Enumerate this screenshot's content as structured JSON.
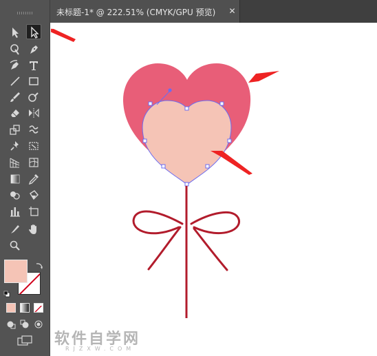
{
  "document": {
    "tab_title": "未标题-1* @ 222.51% (CMYK/GPU 预览)",
    "close_glyph": "✕"
  },
  "toolbar": {
    "tools": [
      {
        "name": "selection-tool",
        "icon": "arrow-black-icon"
      },
      {
        "name": "direct-selection-tool",
        "icon": "arrow-white-icon",
        "active": true
      },
      {
        "name": "magic-wand-tool",
        "icon": "magic-wand-icon"
      },
      {
        "name": "pen-tool",
        "icon": "pen-icon"
      },
      {
        "name": "curvature-tool",
        "icon": "curvature-icon"
      },
      {
        "name": "type-tool",
        "icon": "type-icon"
      },
      {
        "name": "line-tool",
        "icon": "line-segment-icon"
      },
      {
        "name": "rectangle-tool",
        "icon": "rectangle-icon"
      },
      {
        "name": "paintbrush-tool",
        "icon": "paintbrush-icon"
      },
      {
        "name": "shaper-tool",
        "icon": "shaper-icon"
      },
      {
        "name": "eraser-tool",
        "icon": "eraser-icon"
      },
      {
        "name": "reflect-tool",
        "icon": "reflect-icon"
      },
      {
        "name": "scale-tool",
        "icon": "scale-icon"
      },
      {
        "name": "warp-tool",
        "icon": "warp-icon"
      },
      {
        "name": "puppet-warp-tool",
        "icon": "pushpin-icon"
      },
      {
        "name": "free-transform-tool",
        "icon": "free-transform-icon"
      },
      {
        "name": "perspective-grid-tool",
        "icon": "perspective-grid-icon"
      },
      {
        "name": "mesh-tool",
        "icon": "mesh-icon"
      },
      {
        "name": "gradient-tool",
        "icon": "gradient-icon"
      },
      {
        "name": "eyedropper-tool",
        "icon": "eyedropper-icon"
      },
      {
        "name": "shape-builder-tool",
        "icon": "shape-builder-icon"
      },
      {
        "name": "live-paint-tool",
        "icon": "live-paint-bucket-icon"
      },
      {
        "name": "column-graph-tool",
        "icon": "bar-graph-icon"
      },
      {
        "name": "artboard-tool",
        "icon": "artboard-icon"
      },
      {
        "name": "slice-tool",
        "icon": "slice-knife-icon"
      },
      {
        "name": "hand-tool",
        "icon": "hand-icon"
      },
      {
        "name": "zoom-tool",
        "icon": "zoom-icon"
      }
    ],
    "colors": {
      "fill": "#f5c4b6",
      "stroke_none_accent": "#d0021b",
      "panel_bg": "#535353"
    }
  },
  "artwork": {
    "heart_outer_color": "#e85e78",
    "heart_inner_color": "#f5c4b6",
    "path_highlight_color": "#6c6cf0",
    "ribbon_color": "#b21c2c",
    "arrow_color": "#ee2323"
  },
  "watermark": {
    "main": "软件自学网",
    "sub": "RJZXW.COM"
  }
}
